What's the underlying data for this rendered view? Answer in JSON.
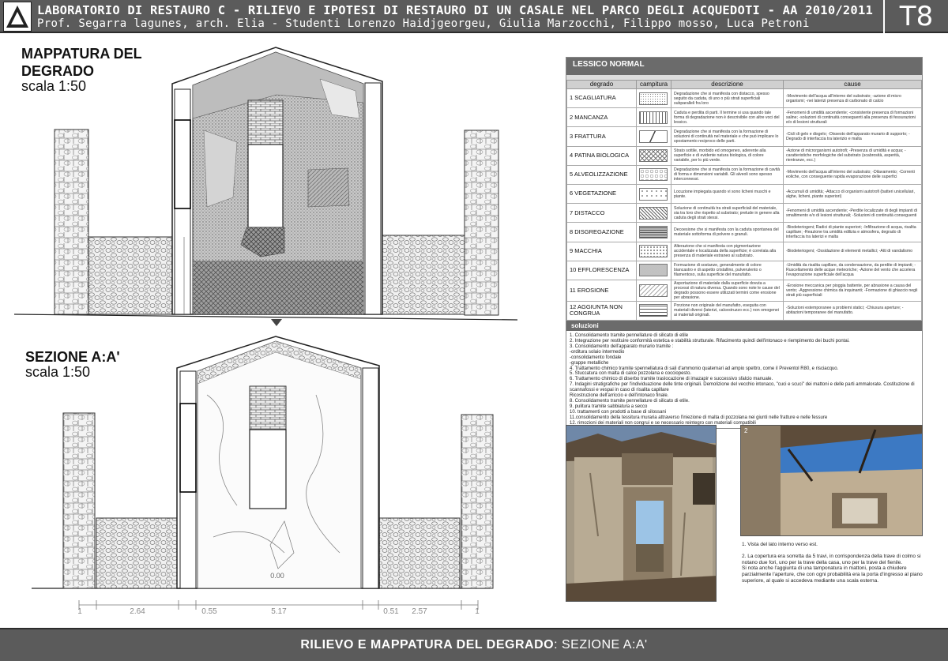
{
  "header": {
    "line1": "LABORATORIO DI RESTAURO C - RILIEVO E IPOTESI DI RESTAURO DI UN CASALE NEL PARCO DEGLI ACQUEDOTI - AA 2010/2011",
    "line2": "Prof. Segarra lagunes, arch. Elia - Studenti Lorenzo Haidjgeorgeu, Giulia Marzocchi, Filippo mosso, Luca Petroni",
    "code": "T8"
  },
  "sections": {
    "mapping_title": "MAPPATURA DEL DEGRADO",
    "mapping_scale": "scala 1:50",
    "section_title": "SEZIONE A:A'",
    "section_scale": "scala 1:50"
  },
  "dimensions": [
    "1",
    "2.64",
    "0.55",
    "5.17",
    "0.51",
    "2.57",
    "1"
  ],
  "level_label": "0.00",
  "legend": {
    "title": "LESSICO NORMAL",
    "columns": [
      "degrado",
      "campitura",
      "descrizione",
      "cause"
    ],
    "rows": [
      {
        "name": "1 SCAGLIATURA",
        "pattern": "dots-fine",
        "desc": "Degradazione che si manifesta con distacco, spesso seguito da caduta, di uno o più strati superficiali subparalleli fra loro",
        "cause": "-Movimento dell'acqua all'interno del substrato; -azione di micro organismi; -nei laterizi presenza di carbonato di calcio"
      },
      {
        "name": "2 MANCANZA",
        "pattern": "vlines",
        "desc": "Caduta e perdita di parti. Il termine si usa quando tale forma di degradazione non è descrivibile con altre voci del lessico.",
        "cause": "-Fenomeni di umidità ascendente; -consistente presenza di formazioni saline; -soluzioni di continuità conseguenti alla presenza di fessurazioni e/o di lesioni strutturali"
      },
      {
        "name": "3 FRATTURA",
        "pattern": "slash",
        "desc": "Degradazione che si manifesta con la formazione di soluzioni di continuità nel materiale e che può implicare lo spostamento reciproco delle parti.",
        "cause": "-Cicli di gelo e disgelo; -Dissesto dell'apparato murario di supporto; -Degrado di interfaccia tra laterizio e malta"
      },
      {
        "name": "4 PATINA BIOLOGICA",
        "pattern": "crosshatch",
        "desc": "Strato sottile, morbido ed omogeneo, aderente alla superficie e di evidente natura biologica, di colore variabile, per lo più verde.",
        "cause": "-Azione di microrganismi autotrofi; -Presenza di umidità e acqua; -caratteristiche morfologiche del substrato (scabrosità, asperità, rientranze, ecc.)"
      },
      {
        "name": "5 ALVEOLIZZAZIONE",
        "pattern": "circles",
        "desc": "Degradazione che si manifesta con la formazione di cavità di forma e dimensioni variabili. Gli alveoli sono spesso interconnessi.",
        "cause": "-Movimento dell'acqua all'interno del substrato; -Dilavamento; -Correnti eoliche, con conseguente rapida evaporazione delle superfici"
      },
      {
        "name": "6 VEGETAZIONE",
        "pattern": "dots-sparse",
        "desc": "Locuzione impiegata quando vi sono licheni muschi e piante.",
        "cause": "-Accumuli di umidità; -Attacco di organismi autotrofi (batteri unicellulari, alghe, licheni, piante superiori)"
      },
      {
        "name": "7 DISTACCO",
        "pattern": "hatch",
        "desc": "Soluzione di continuità tra strati superficiali del materiale, sia tra loro che rispetto al substrato; prelude in genere alla caduta degli strati stessi.",
        "cause": "-Fenomeni di umidità ascendente; -Perdite localizzate di degli impianti di smaltimento e/o di lesioni strutturali; -Soluzioni di continuità conseguenti"
      },
      {
        "name": "8 DISGREGAZIONE",
        "pattern": "grid",
        "desc": "Decoesione che si manifesta con la caduta spontanea del materiale sottoforma di polvere o granuli.",
        "cause": "-Biodeteriogeni; Radici di piante superiori; -Infiltrazione di acqua, risalita capillare; -Reazione tra umidità edilizia e atmosfera, degrado di interfaccia tra laterizi e malta"
      },
      {
        "name": "9 MACCHIA",
        "pattern": "dots-medium",
        "desc": "Alterazione che si manifesta con pigmentazione accidentale e localizzata della superficie; è correlata alla presenza di materiale estraneo al substrato.",
        "cause": "-Biodeteriogeni; -Ossidazione di elementi metallici; -Atti di vandalismo"
      },
      {
        "name": "10 EFFLORESCENZA",
        "pattern": "dots-dense",
        "desc": "Formazione di sostanze, generalmente di colore biancastro e di aspetto cristallino, pulverulento o filamentoso, sulla superficie del manufatto.",
        "cause": "-Umidità da risalita capillare, da condensazione, da perdite di impianti; -Ruscellamento delle acque meteoriche; -Azione del vento che accelera l'evaporazione superficiale dell'acqua"
      },
      {
        "name": "11 EROSIONE",
        "pattern": "diag-light",
        "desc": "Asportazione di materiale dalla superficie dovuta a processi di natura diversa. Quando sono note le cause del degrado possono essere utilizzati termini come erosione per abrasione.",
        "cause": "-Erosione meccanica per pioggia battente, per abrasione a causa del vento; -Aggressione chimica da inquinanti; -Formazione di ghiaccio negli strati più superficiali"
      },
      {
        "name": "12 AGGIUNTA NON CONGRUA",
        "pattern": "bricks",
        "desc": "Porzione non originale del manufatto, eseguita con materiali diversi (laterizi, calcestruzzo ecc.) non omogenei ai materiali originali.",
        "cause": "-Soluzioni estemporanee a problemi statici; -Chiusura aperture; -abitazioni temporanee del manufatto."
      }
    ],
    "solutions_title": "soluzioni",
    "solutions": [
      "1. Consolidamento tramite pennellature di silicato di etile",
      "2. Integrazione per restituire conformità estetica e stabilità strutturale. Rifacimento quindi dell'intonaco e riempimento dei buchi pontai.",
      "3. Consolidamento dell'apparato murario tramite :",
      "-orditura solaio intermedio",
      "-consolidamento fondale",
      "-grappe metalliche",
      "4. Trattamento chimico tramite spennellatura di sali d'ammonio quaternari ad ampio spettro, come il Preventol R80, e risciacquo.",
      "5. Stuccatura con malta di calce pozzolana e cocciopesto.",
      "6. Trattamento chimico di diserbo tramite traslocazione di imazapir e successivo sfalcio manuale.",
      "7. Indagini stratigrafiche per l'individuazione delle tinte originali. Demolizione del vecchio intonaco, \"cuci e scuci\" dei mattoni e delle parti ammalorate. Costituzione di scannafossi e vespai in caso di risalita capillare",
      "Ricostruzione dell'arriccio e dell'intonaco finale.",
      "8. Consolidamento tramite pennellature di silicato di etile.",
      "9. pulitura tramite sabbiatura a secco",
      "10. trattamenti con prodotti a base di silossani",
      "11.consolidamento della tessitura muraria attraverso l'iniezione di malta di pozzolana nei giunti nelle fratture e nelle fessure",
      "12. rimozioni dei materiali non congrui e se necessario reintegro con materiali compatibili"
    ]
  },
  "photos": {
    "photo2_number": "2"
  },
  "caption": {
    "p1": "1. Vista del lato interno verso est.",
    "p2": "2. La copertura era sorretta da 5 travi, in corrispondenza della trave di colmo si notano due fori, uno per la trave della casa, uno per la trave del fienile.",
    "p3": "Si nota anche l'aggiunta di una tamponatura in mattoni, posta a chiudere parzialmente l'aperture, che con ogni probabilità era la porta d'ingresso al piano superiore, al quale si accedeva mediante una scala esterna."
  },
  "footer": {
    "bold": "RILIEVO E MAPPATURA DEL DEGRADO",
    "rest": ": SEZIONE A:A'"
  }
}
